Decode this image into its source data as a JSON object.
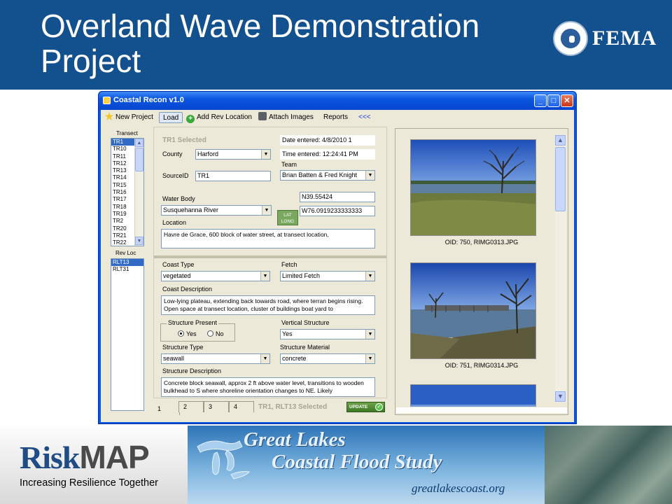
{
  "slide": {
    "title": "Overland Wave Demonstration Project",
    "agency_logo_text": "FEMA",
    "colors": {
      "banner": "#12508e",
      "accent": "#0a56e0"
    }
  },
  "window": {
    "title": "Coastal Recon v1.0",
    "controls": {
      "minimize": "_",
      "maximize": "□",
      "close": "✕"
    }
  },
  "toolbar": {
    "new_project": "New Project",
    "load": "Load",
    "add_rev_location": "Add Rev Location",
    "attach_images": "Attach Images",
    "reports": "Reports",
    "collapse": "<<<"
  },
  "transect_panel": {
    "label": "Transect",
    "items": [
      "TR1",
      "TR10",
      "TR11",
      "TR12",
      "TR13",
      "TR14",
      "TR15",
      "TR16",
      "TR17",
      "TR18",
      "TR19",
      "TR2",
      "TR20",
      "TR21",
      "TR22"
    ],
    "selected_index": 0,
    "rev_loc_label": "Rev Loc",
    "rev_loc_items": [
      "RLT13",
      "RLT31"
    ],
    "rev_loc_selected_index": 0
  },
  "form": {
    "selected_heading": "TR1 Selected",
    "date_entered": "Date entered: 4/8/2010 1",
    "time_entered": "Time entered: 12:24:41 PM",
    "county_label": "County",
    "county_value": "Harford",
    "sourceid_label": "SourceID",
    "sourceid_value": "TR1",
    "team_label": "Team",
    "team_value": "Brian Batten & Fred Knight",
    "water_body_label": "Water Body",
    "water_body_value": "Susquehanna River",
    "latlong_button": "LAT LONG",
    "lat_value": "N39.55424",
    "long_value": "W76.0919233333333",
    "location_label": "Location",
    "location_value": "Havre de Grace, 600 block of water street, at transect location,",
    "coast_type_label": "Coast Type",
    "coast_type_value": "vegetated",
    "fetch_label": "Fetch",
    "fetch_value": "Limited Fetch",
    "coast_desc_label": "Coast Description",
    "coast_desc_value": "Low-lying plateau, extending back towards road, where terran begins rising.  Open space at transect location, cluster of buildings  boat yard to",
    "structure_present_label": "Structure Present",
    "structure_yes": "Yes",
    "structure_no": "No",
    "structure_present_value": "Yes",
    "vertical_structure_label": "Vertical Structure",
    "vertical_structure_value": "Yes",
    "structure_type_label": "Structure Type",
    "structure_type_value": "seawall",
    "structure_material_label": "Structure Material",
    "structure_material_value": "concrete",
    "structure_desc_label": "Structure Description",
    "structure_desc_value": "Concrete block seawall, approx 2 ft above water level, transitions to wooden bulkhead to S where shoreline orientation changes to NE.  Likely"
  },
  "tabs": {
    "items": [
      "1",
      "2",
      "3",
      "4"
    ],
    "active": "1",
    "status": "TR1, RLT13 Selected",
    "update_button": "UPDATE"
  },
  "images": {
    "items": [
      {
        "caption": "OID: 750, RIMG0313.JPG"
      },
      {
        "caption": "OID: 751, RIMG0314.JPG"
      }
    ]
  },
  "footer": {
    "riskmap_risk": "Risk",
    "riskmap_map": "MAP",
    "riskmap_tagline": "Increasing Resilience Together",
    "gl_title_line1": "Great Lakes",
    "gl_title_line2": "Coastal Flood Study",
    "gl_url": "greatlakescoast.org"
  }
}
